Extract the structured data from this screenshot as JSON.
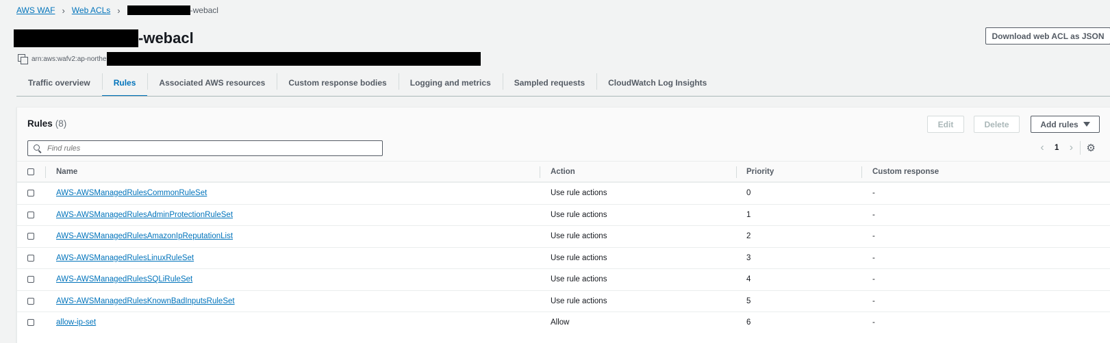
{
  "breadcrumb": {
    "items": [
      "AWS WAF",
      "Web ACLs"
    ],
    "current_suffix": "-webacl"
  },
  "page": {
    "title_suffix": "-webacl",
    "download_label": "Download web ACL as JSON",
    "arn_prefix": "arn:aws:wafv2:ap-northe"
  },
  "tabs": [
    "Traffic overview",
    "Rules",
    "Associated AWS resources",
    "Custom response bodies",
    "Logging and metrics",
    "Sampled requests",
    "CloudWatch Log Insights"
  ],
  "active_tab": "Rules",
  "rules_panel": {
    "title": "Rules",
    "count": "(8)",
    "edit_label": "Edit",
    "delete_label": "Delete",
    "add_label": "Add rules",
    "search_placeholder": "Find rules",
    "page_number": "1"
  },
  "table": {
    "columns": [
      "Name",
      "Action",
      "Priority",
      "Custom response"
    ],
    "rows": [
      {
        "name": "AWS-AWSManagedRulesCommonRuleSet",
        "action": "Use rule actions",
        "priority": "0",
        "custom": "-"
      },
      {
        "name": "AWS-AWSManagedRulesAdminProtectionRuleSet",
        "action": "Use rule actions",
        "priority": "1",
        "custom": "-"
      },
      {
        "name": "AWS-AWSManagedRulesAmazonIpReputationList",
        "action": "Use rule actions",
        "priority": "2",
        "custom": "-"
      },
      {
        "name": "AWS-AWSManagedRulesLinuxRuleSet",
        "action": "Use rule actions",
        "priority": "3",
        "custom": "-"
      },
      {
        "name": "AWS-AWSManagedRulesSQLiRuleSet",
        "action": "Use rule actions",
        "priority": "4",
        "custom": "-"
      },
      {
        "name": "AWS-AWSManagedRulesKnownBadInputsRuleSet",
        "action": "Use rule actions",
        "priority": "5",
        "custom": "-"
      },
      {
        "name": "allow-ip-set",
        "action": "Allow",
        "priority": "6",
        "custom": "-"
      }
    ]
  },
  "icons": {
    "breadcrumb_separator": "chevron-right-icon",
    "copy": "copy-icon",
    "search": "search-icon",
    "prev": "chevron-left-icon",
    "next": "chevron-right-icon",
    "settings": "gear-icon",
    "add_dropdown": "caret-down-icon"
  },
  "colors": {
    "link": "#0073bb",
    "background": "#f2f3f3",
    "text": "#16191f",
    "muted": "#545b64"
  }
}
